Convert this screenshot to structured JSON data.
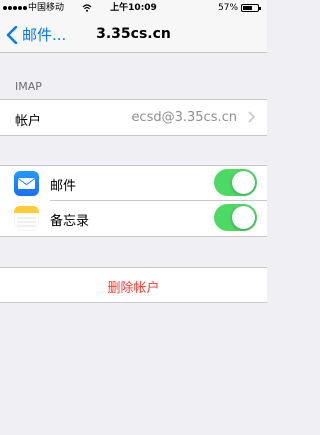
{
  "status_bar": {
    "carrier": "中国移动",
    "time": "上午10:09",
    "battery_percent": "57%",
    "battery_level": 0.57
  },
  "nav": {
    "back_label": "邮件...",
    "title": "3.35cs.cn"
  },
  "imap_section": {
    "header": "IMAP",
    "account_label": "帐户",
    "account_value": "ecsd@3.35cs.cn"
  },
  "apps": [
    {
      "label": "邮件",
      "icon": "mail-icon",
      "enabled": true
    },
    {
      "label": "备忘录",
      "icon": "notes-icon",
      "enabled": true
    }
  ],
  "delete_label": "删除帐户",
  "colors": {
    "accent": "#007aff",
    "toggle_on": "#4cd964",
    "destructive": "#ff3b30",
    "background": "#efeff4"
  }
}
